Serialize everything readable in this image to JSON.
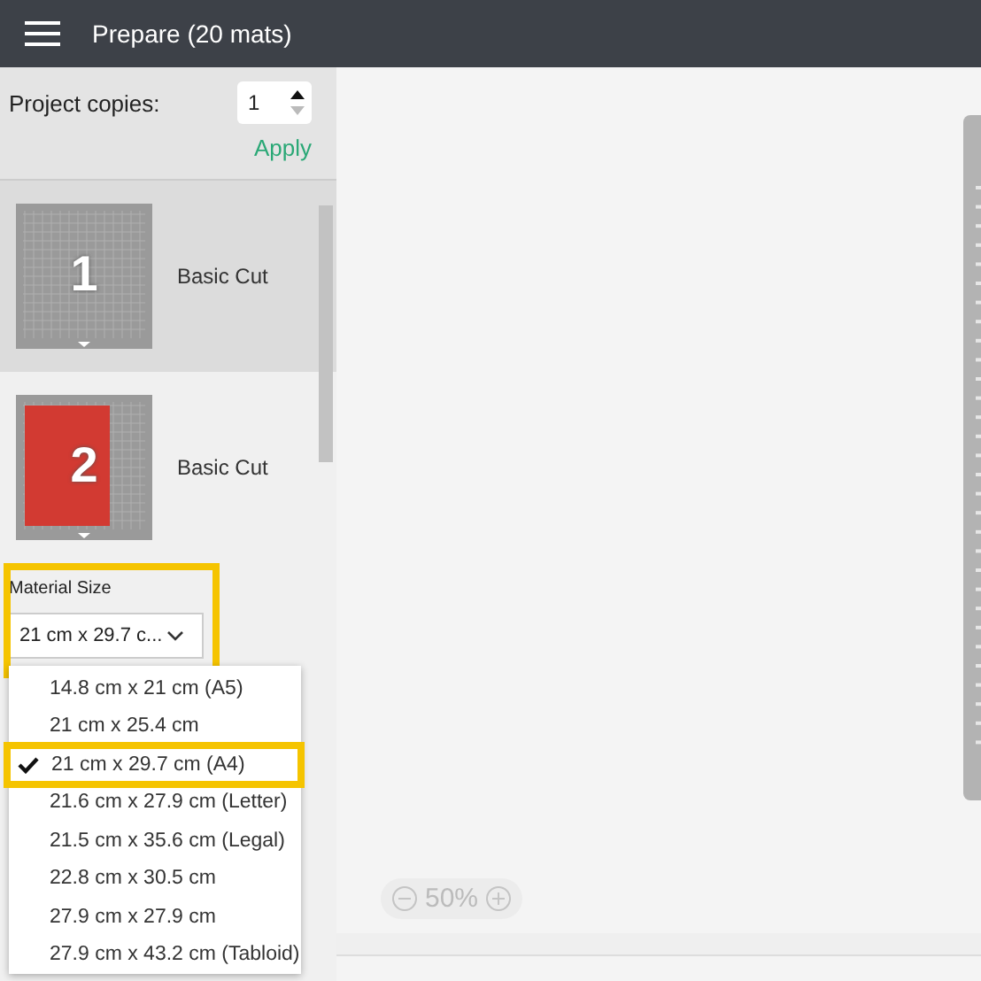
{
  "header": {
    "title": "Prepare (20 mats)"
  },
  "copies": {
    "label": "Project copies:",
    "value": "1",
    "action": "Apply"
  },
  "mats": [
    {
      "number": "1",
      "name": "Basic Cut",
      "selected": true,
      "kind": "blank"
    },
    {
      "number": "2",
      "name": "Basic Cut",
      "selected": false,
      "kind": "red"
    }
  ],
  "material_size": {
    "label": "Material Size",
    "value": "21 cm x 29.7 c...",
    "highlighted": true
  },
  "size_options": [
    {
      "label": "14.8 cm x 21 cm (A5)",
      "selected": false
    },
    {
      "label": "21 cm x 25.4 cm",
      "selected": false
    },
    {
      "label": "21 cm x 29.7 cm (A4)",
      "selected": true
    },
    {
      "label": "21.6 cm x 27.9 cm (Letter)",
      "selected": false
    },
    {
      "label": "21.5 cm x 35.6 cm (Legal)",
      "selected": false
    },
    {
      "label": "22.8 cm x 30.5 cm",
      "selected": false
    },
    {
      "label": "27.9 cm x 27.9 cm",
      "selected": false
    },
    {
      "label": "27.9 cm x 43.2 cm (Tabloid)",
      "selected": false
    }
  ],
  "zoom": {
    "reading": "50%"
  }
}
